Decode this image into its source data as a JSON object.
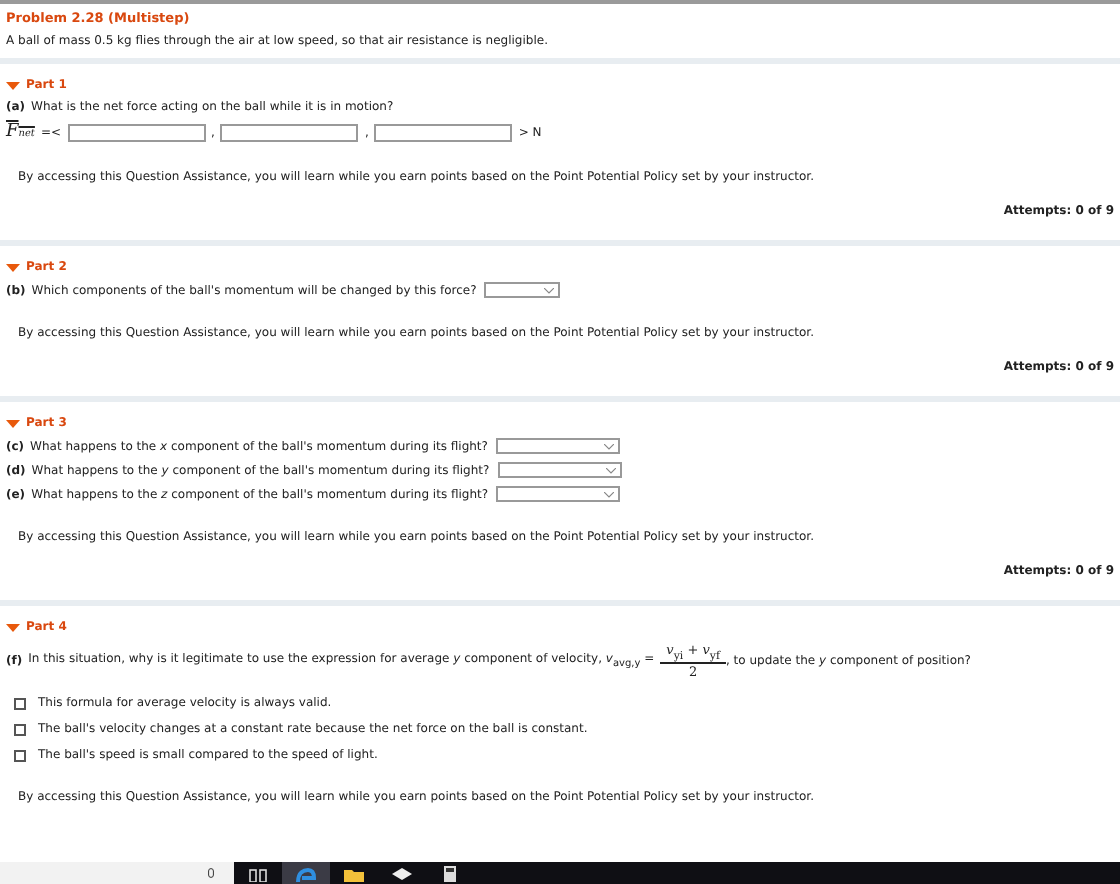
{
  "problem": {
    "title": "Problem 2.28 (Multistep)",
    "statement": "A ball of mass 0.5 kg flies through the air at low speed, so that air resistance is negligible."
  },
  "parts": [
    {
      "label": "Part 1",
      "expanded": true,
      "questions": [
        {
          "kind": "vector",
          "tag": "(a)",
          "text": "What is the net force acting on the ball while it is in motion?",
          "symbol": "F",
          "subscript": "net",
          "open": "=<",
          "separators": [
            ",",
            ","
          ],
          "unit": "> N"
        }
      ],
      "policy": "By accessing this Question Assistance, you will learn while you earn points based on the Point Potential Policy set by your instructor.",
      "attempts": "Attempts: 0 of 9"
    },
    {
      "label": "Part 2",
      "expanded": true,
      "questions": [
        {
          "kind": "select",
          "tag": "(b)",
          "text": "Which components of the ball's momentum will be changed by this force?"
        }
      ],
      "policy": "By accessing this Question Assistance, you will learn while you earn points based on the Point Potential Policy set by your instructor.",
      "attempts": "Attempts: 0 of 9"
    },
    {
      "label": "Part 3",
      "expanded": true,
      "questions": [
        {
          "kind": "select",
          "tag": "(c)",
          "text": "What happens to the *x* component of the ball's momentum during its flight?"
        },
        {
          "kind": "select",
          "tag": "(d)",
          "text": "What happens to the *y* component of the ball's momentum during its flight?"
        },
        {
          "kind": "select",
          "tag": "(e)",
          "text": "What happens to the *z* component of the ball's momentum during its flight?"
        }
      ],
      "policy": "By accessing this Question Assistance, you will learn while you earn points based on the Point Potential Policy set by your instructor.",
      "attempts": "Attempts: 0 of 9"
    },
    {
      "label": "Part 4",
      "expanded": true,
      "questions": [
        {
          "kind": "choice",
          "tag": "(f)",
          "text": "In this situation, why is it legitimate to use the expression for average *y* component of velocity, *v*$_{avg,y}$ =",
          "numerator": "*v*$_{yi}$ + *v*$_{yf}$",
          "denominator": "2",
          "after": ", to update the *y* component of position?",
          "options": [
            {
              "text": "This formula for average velocity is always valid.",
              "checked": false
            },
            {
              "text": "The ball's velocity changes at a constant rate because the net force on the ball is constant.",
              "checked": false
            },
            {
              "text": "The ball's speed is small compared to the speed of light.",
              "checked": false
            }
          ]
        }
      ],
      "policy": "By accessing this Question Assistance, you will learn while you earn points based on the Point Potential Policy set by your instructor."
    }
  ],
  "taskbar": {
    "apps": [
      {
        "kind": "taskview",
        "selected": false
      },
      {
        "kind": "browser",
        "selected": true
      },
      {
        "kind": "folder",
        "selected": false
      },
      {
        "kind": "mail",
        "selected": false
      },
      {
        "kind": "calculator",
        "selected": false
      }
    ]
  }
}
